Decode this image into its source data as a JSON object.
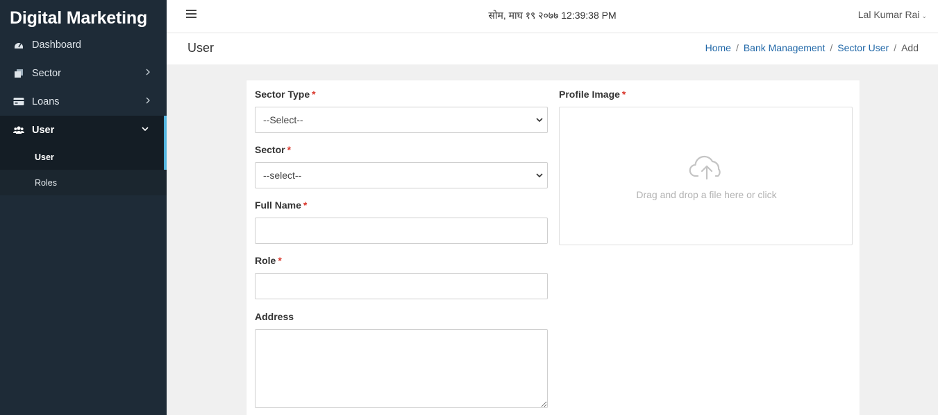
{
  "app": {
    "brand": "Digital Marketing"
  },
  "sidebar": {
    "items": [
      {
        "label": "Dashboard",
        "icon": "dashboard-icon"
      },
      {
        "label": "Sector",
        "icon": "sector-icon"
      },
      {
        "label": "Loans",
        "icon": "loans-icon"
      },
      {
        "label": "User",
        "icon": "users-icon"
      }
    ],
    "submenu": [
      {
        "label": "User"
      },
      {
        "label": "Roles"
      }
    ]
  },
  "topbar": {
    "datetime": "सोम, माघ १९ २०७७ 12:39:38 PM",
    "user_name": "Lal Kumar Rai"
  },
  "page": {
    "title": "User",
    "breadcrumb": [
      "Home",
      "Bank Management",
      "Sector User",
      "Add"
    ]
  },
  "form": {
    "required_mark": "*",
    "sector_type": {
      "label": "Sector Type",
      "selected": "--Select--"
    },
    "sector": {
      "label": "Sector",
      "selected": "--select--"
    },
    "full_name": {
      "label": "Full Name",
      "value": ""
    },
    "role": {
      "label": "Role",
      "value": ""
    },
    "address": {
      "label": "Address",
      "value": ""
    },
    "profile_image": {
      "label": "Profile Image",
      "dropzone_text": "Drag and drop a file here or click"
    }
  },
  "colors": {
    "sidebar_bg": "#1e2b37",
    "accent": "#52b5e0",
    "link": "#2168a8",
    "required": "#d9362b"
  }
}
